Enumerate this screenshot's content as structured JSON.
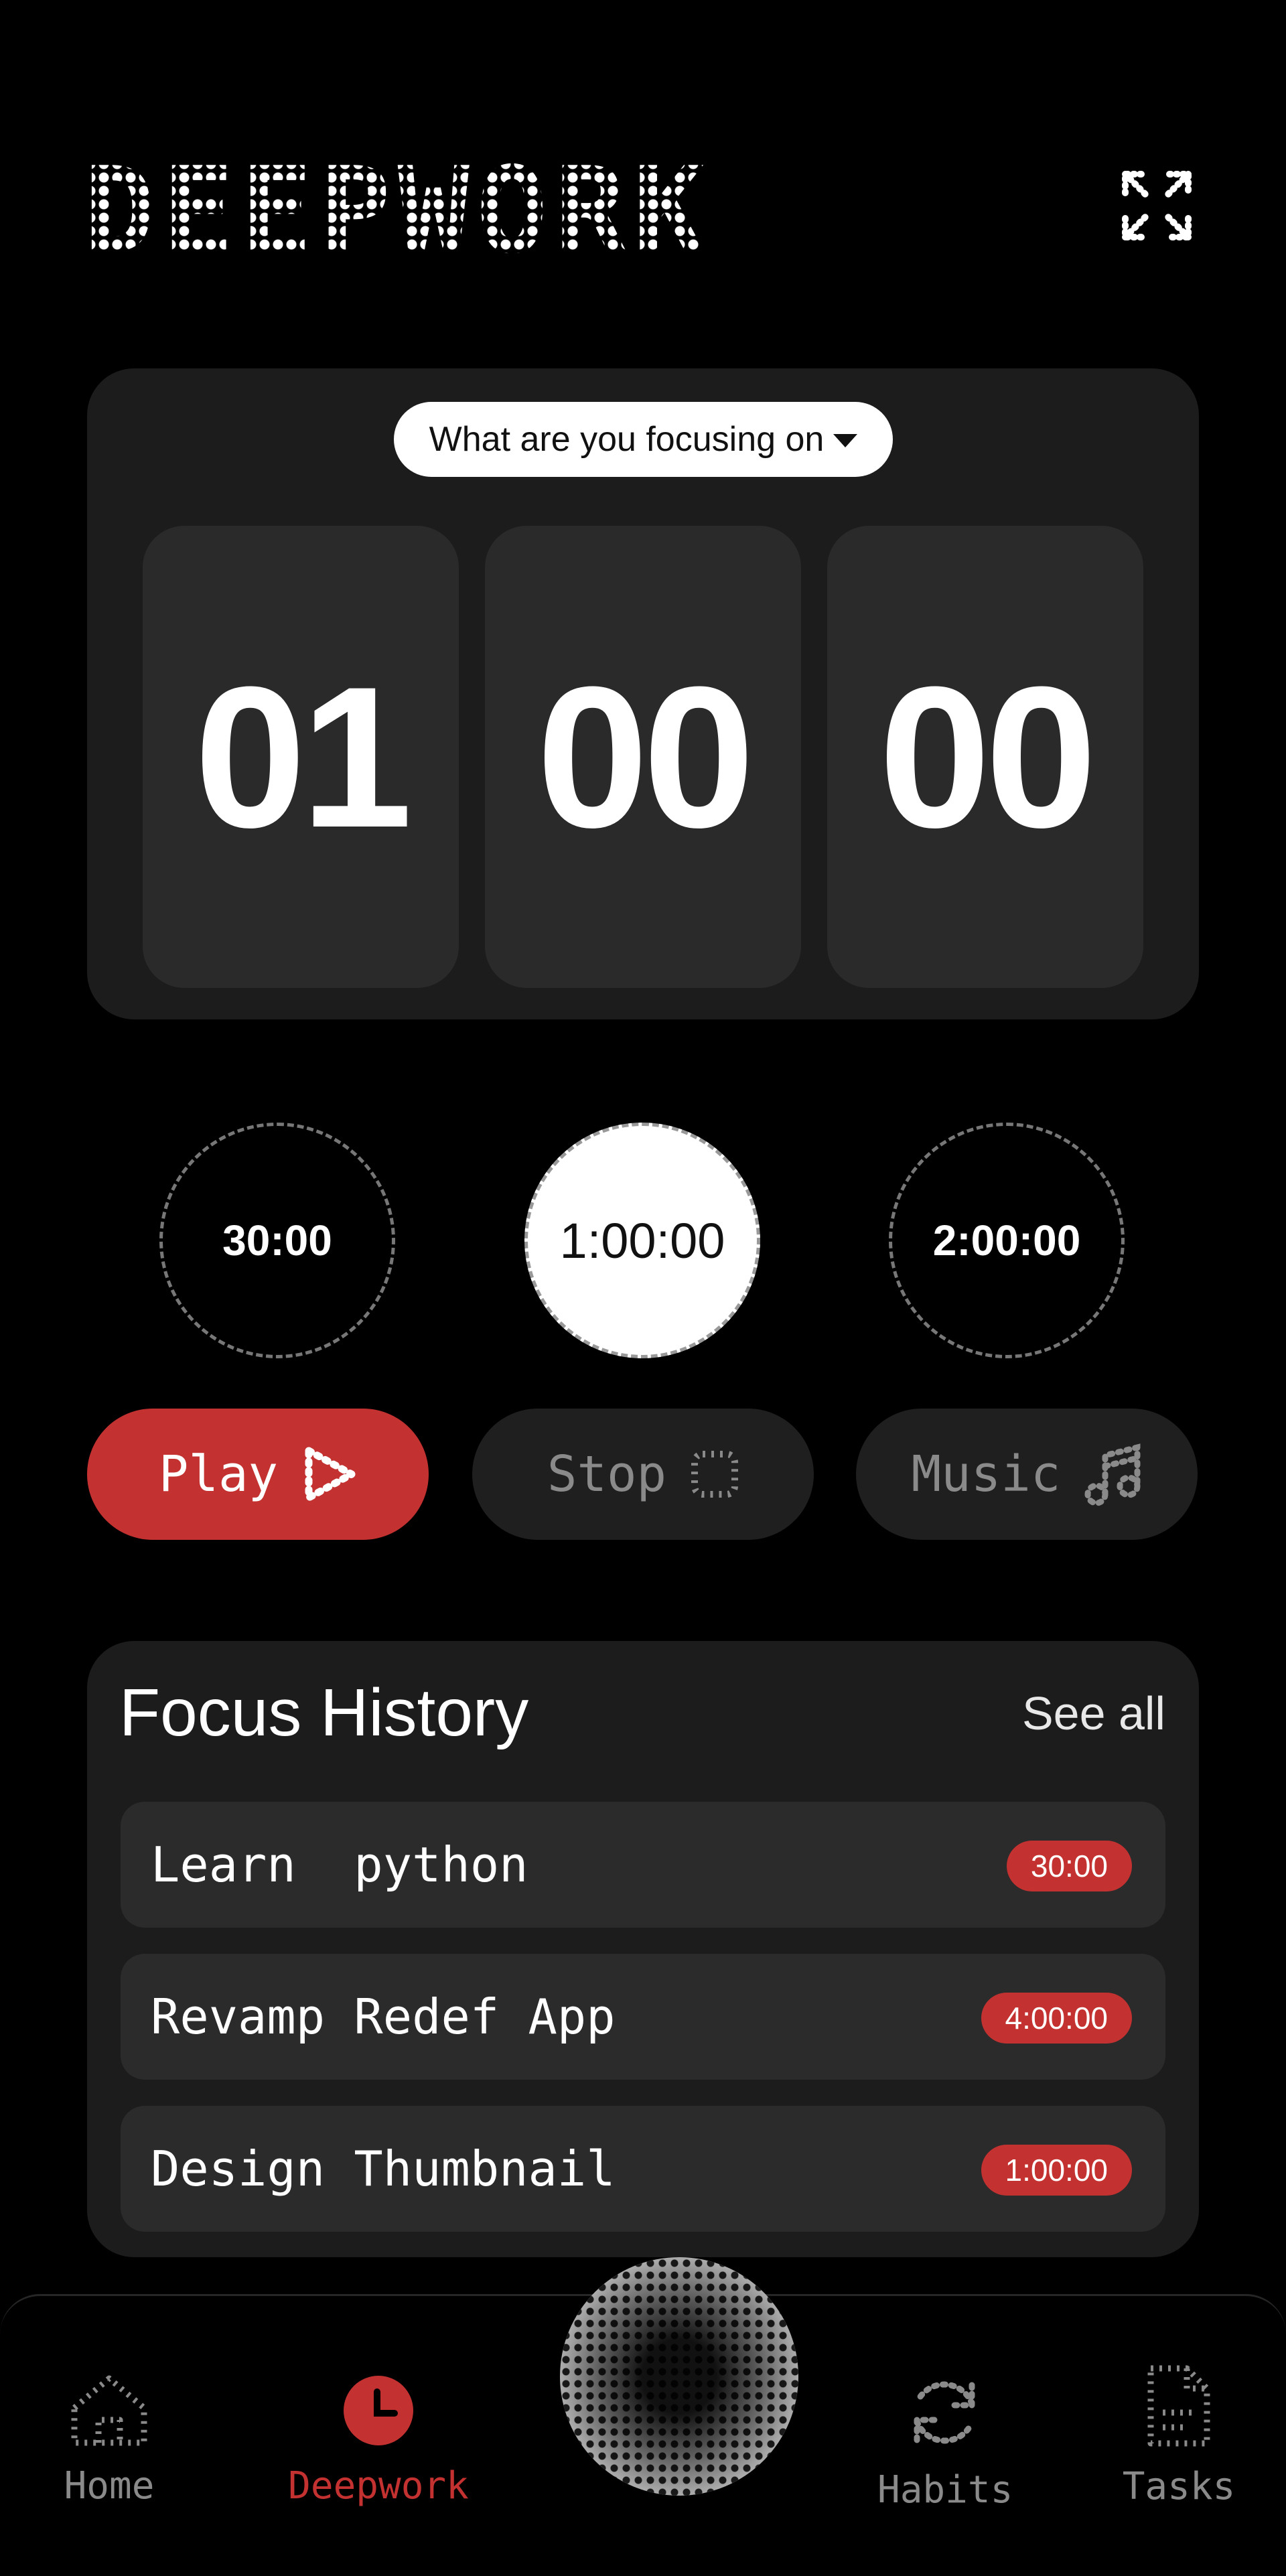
{
  "app": {
    "title": "DEEPWORK"
  },
  "header": {
    "expand_icon": "expand-icon"
  },
  "timer": {
    "focus_prompt": "What are you focusing on",
    "hours": "01",
    "minutes": "00",
    "seconds": "00"
  },
  "presets": [
    {
      "label": "30:00",
      "active": false
    },
    {
      "label": "1:00:00",
      "active": true
    },
    {
      "label": "2:00:00",
      "active": false
    }
  ],
  "controls": {
    "play_label": "Play",
    "stop_label": "Stop",
    "music_label": "Music"
  },
  "history": {
    "title": "Focus History",
    "see_all": "See all",
    "items": [
      {
        "label": "Learn  python",
        "duration": "30:00"
      },
      {
        "label": "Revamp Redef App",
        "duration": "4:00:00"
      },
      {
        "label": "Design Thumbnail",
        "duration": "1:00:00"
      }
    ]
  },
  "nav": {
    "items": [
      {
        "label": "Home",
        "icon": "home-icon",
        "active": false
      },
      {
        "label": "Deepwork",
        "icon": "clock-icon",
        "active": true
      },
      {
        "label": "Habits",
        "icon": "refresh-icon",
        "active": false
      },
      {
        "label": "Tasks",
        "icon": "document-icon",
        "active": false
      }
    ]
  },
  "colors": {
    "accent": "#c43131",
    "background": "#000000",
    "card": "#1c1c1c",
    "tile": "#2a2a2a"
  }
}
